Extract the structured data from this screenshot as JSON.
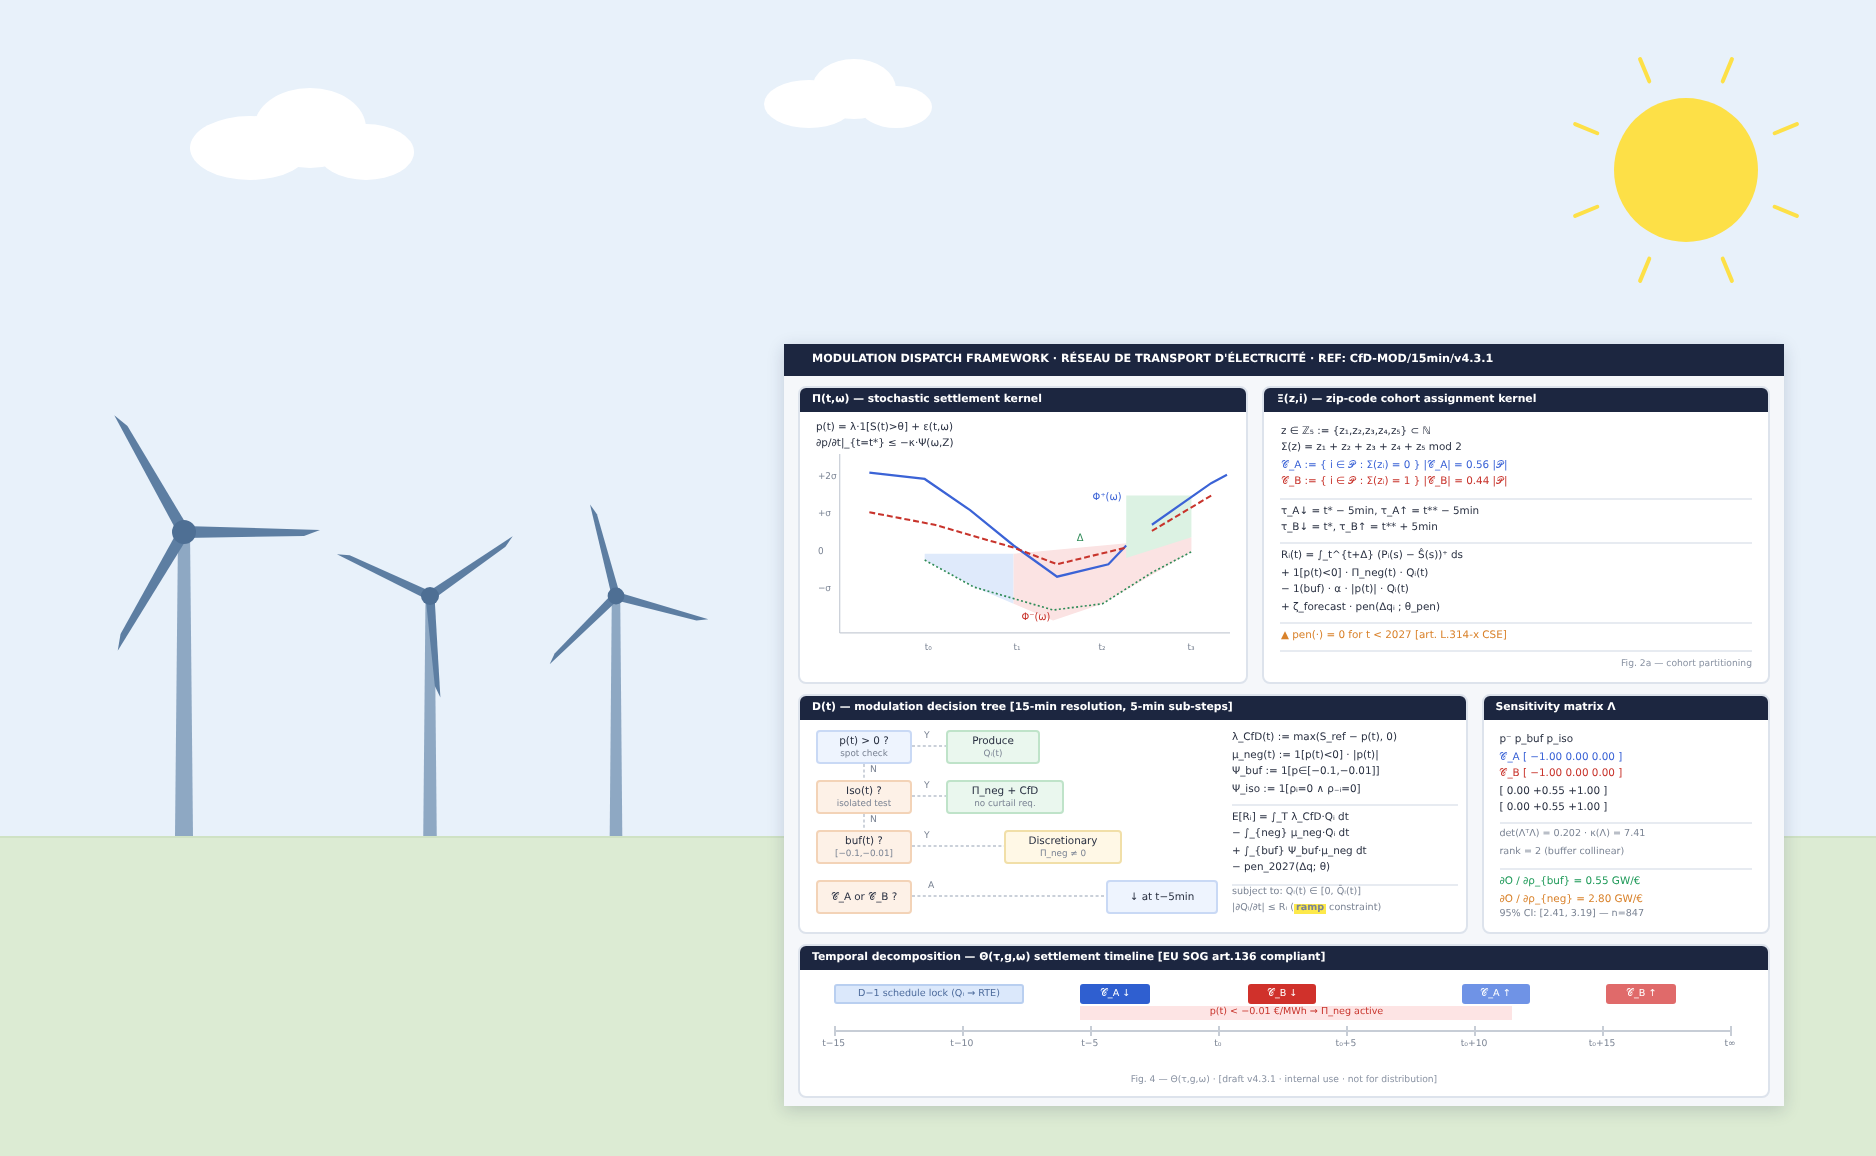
{
  "document": {
    "title": "MODULATION DISPATCH FRAMEWORK · RÉSEAU DE TRANSPORT D'ÉLECTRICITÉ · REF: CfD-MOD/15min/v4.3.1",
    "settlement_kernel": {
      "title": "Π(t,ω) — stochastic settlement kernel",
      "equations": [
        "p(t) = λ·1[S(t)>θ] + ε(t,ω)",
        "∂p/∂t|_{t=t*} ≤ −κ·Ψ(ω,Z)"
      ],
      "y_ticks": [
        "+2σ",
        "+σ",
        "0",
        "−σ"
      ],
      "x_ticks": [
        "t₀",
        "t₁",
        "t₂",
        "t₃"
      ],
      "curve_labels": [
        {
          "text": "Φ⁺(ω)",
          "kind": "upper"
        },
        {
          "text": "Φ⁻(ω)",
          "kind": "lower"
        },
        {
          "text": "Δ",
          "kind": "gap"
        }
      ]
    },
    "cohort_kernel": {
      "title": "Ξ(z,i) — zip-code cohort assignment kernel",
      "groups": [
        [
          {
            "text": "z ∈ ℤ₅ := {z₁,z₂,z₃,z₄,z₅} ⊂ ℕ",
            "kind": "plain"
          },
          {
            "text": "Σ(z) = z₁ + z₂ + z₃ + z₄ + z₅ mod 2",
            "kind": "plain"
          },
          {
            "text": "𝒞_A := { i ∈ 𝒫 : Σ(zᵢ) = 0 }  |𝒞_A| = 0.56 |𝒫|",
            "kind": "cohort_a"
          },
          {
            "text": "𝒞_B := { i ∈ 𝒫 : Σ(zᵢ) = 1 }  |𝒞_B| = 0.44 |𝒫|",
            "kind": "cohort_b"
          }
        ],
        [
          {
            "text": "τ_A↓ = t* − 5min, τ_A↑ = t** − 5min",
            "kind": "plain"
          },
          {
            "text": "τ_B↓ = t*, τ_B↑ = t** + 5min",
            "kind": "plain"
          }
        ],
        [
          {
            "text": "Rᵢ(t) = ∫_t^{t+Δ} (Pᵢ(s) − Ŝ(s))⁺ ds",
            "kind": "plain"
          },
          {
            "text": "+ 1[p(t)<0] · Π_neg(t) · Qᵢ(t)",
            "kind": "plain"
          },
          {
            "text": "− 1(buf) · α · |p(t)| · Qᵢ(t)",
            "kind": "plain"
          },
          {
            "text": "+ ζ_forecast · pen(Δqᵢ ; θ_pen)",
            "kind": "plain"
          }
        ],
        [
          {
            "text": "▲ pen(·) = 0 for t < 2027 [art. L.314-x CSE]",
            "kind": "warning"
          }
        ]
      ],
      "caption": "Fig. 2a — cohort partitioning"
    },
    "decision_tree": {
      "title": "D(t) — modulation decision tree [15-min resolution, 5-min sub-steps]",
      "nodes": [
        {
          "title": "p(t) > 0 ?",
          "subtitle": "spot check",
          "kind": "query"
        },
        {
          "title": "Produce",
          "subtitle": "Qᵢ(t)",
          "kind": "action"
        },
        {
          "title": "Iso(t) ?",
          "subtitle": "isolated test",
          "kind": "test"
        },
        {
          "title": "Π_neg + CfD",
          "subtitle": "no curtail req.",
          "kind": "action"
        },
        {
          "title": "buf(t) ?",
          "subtitle": "[−0.1,−0.01]",
          "kind": "test"
        },
        {
          "title": "Discretionary",
          "subtitle": "Π_neg ≠ 0",
          "kind": "discretion"
        },
        {
          "title": "𝒞_A or 𝒞_B ?",
          "kind": "test"
        },
        {
          "title": "↓ at t−5min",
          "kind": "timing"
        }
      ],
      "edge_labels": [
        "Y",
        "N",
        "Y",
        "N",
        "Y",
        "A"
      ],
      "formulas": [
        "λ_CfD(t) := max(S_ref − p(t), 0)",
        "μ_neg(t) := 1[p(t)<0] · |p(t)|",
        "Ψ_buf := 1[p∈[−0.1,−0.01]]",
        "Ψ_iso := 1[ρᵢ=0 ∧ ρ₋ᵢ=0]"
      ],
      "objective": [
        "E[Rᵢ] = ∫_T λ_CfD·Qᵢ dt",
        "− ∫_{neg} μ_neg·Qᵢ dt",
        "+ ∫_{buf} Ψ_buf·μ_neg dt",
        "− pen_2027(Δq; θ)"
      ],
      "constraints": [
        {
          "before": "subject to: Qᵢ(t) ∈ [0, Q̄ᵢ(t)]"
        },
        {
          "before": "|∂Qᵢ/∂t| ≤ Rᵢ (",
          "highlight": "ramp",
          "after": " constraint)"
        }
      ]
    },
    "sensitivity": {
      "title": "Sensitivity matrix Λ",
      "groups": [
        [
          {
            "text": "p⁻  p_buf  p_iso",
            "kind": "plain"
          },
          {
            "text": "𝒞_A [ −1.00  0.00  0.00 ]",
            "kind": "cohort_a"
          },
          {
            "text": "𝒞_B [ −1.00  0.00  0.00 ]",
            "kind": "cohort_b"
          },
          {
            "text": "[ 0.00  +0.55  +1.00 ]",
            "kind": "plain"
          },
          {
            "text": "[ 0.00  +0.55  +1.00 ]",
            "kind": "plain"
          }
        ],
        [
          {
            "text": "det(ΛᵀΛ) = 0.202 · κ(Λ) = 7.41",
            "kind": "note"
          },
          {
            "text": "rank = 2 (buffer collinear)",
            "kind": "note"
          }
        ],
        [
          {
            "text": "∂O / ∂ρ_{buf} = 0.55 GW/€",
            "kind": "positive"
          },
          {
            "text": "∂O / ∂ρ_{neg} = 2.80 GW/€",
            "kind": "warning"
          },
          {
            "text": "95% CI: [2.41, 3.19] — n=847",
            "kind": "note"
          }
        ]
      ]
    },
    "timeline": {
      "title": "Temporal decomposition — Θ(τ,g,ω) settlement timeline [EU SOG art.136 compliant]",
      "events": [
        {
          "label": "D−1 schedule lock (Qᵢ → RTE)",
          "kind": "lock"
        },
        {
          "label": "𝒞_A ↓",
          "kind": "a_down"
        },
        {
          "label": "𝒞_B ↓",
          "kind": "b_down"
        },
        {
          "label": "𝒞_A ↑",
          "kind": "a_up"
        },
        {
          "label": "𝒞_B ↑",
          "kind": "b_up"
        }
      ],
      "band": "p(t) < −0.01 €/MWh → Π_neg active",
      "ticks": [
        "t−15",
        "t−10",
        "t−5",
        "t₀",
        "t₀+5",
        "t₀+10",
        "t₀+15",
        "t∞"
      ],
      "caption": "Fig. 4 — Θ(τ,g,ω) · [draft v4.3.1 · internal use · not for distribution]"
    }
  }
}
